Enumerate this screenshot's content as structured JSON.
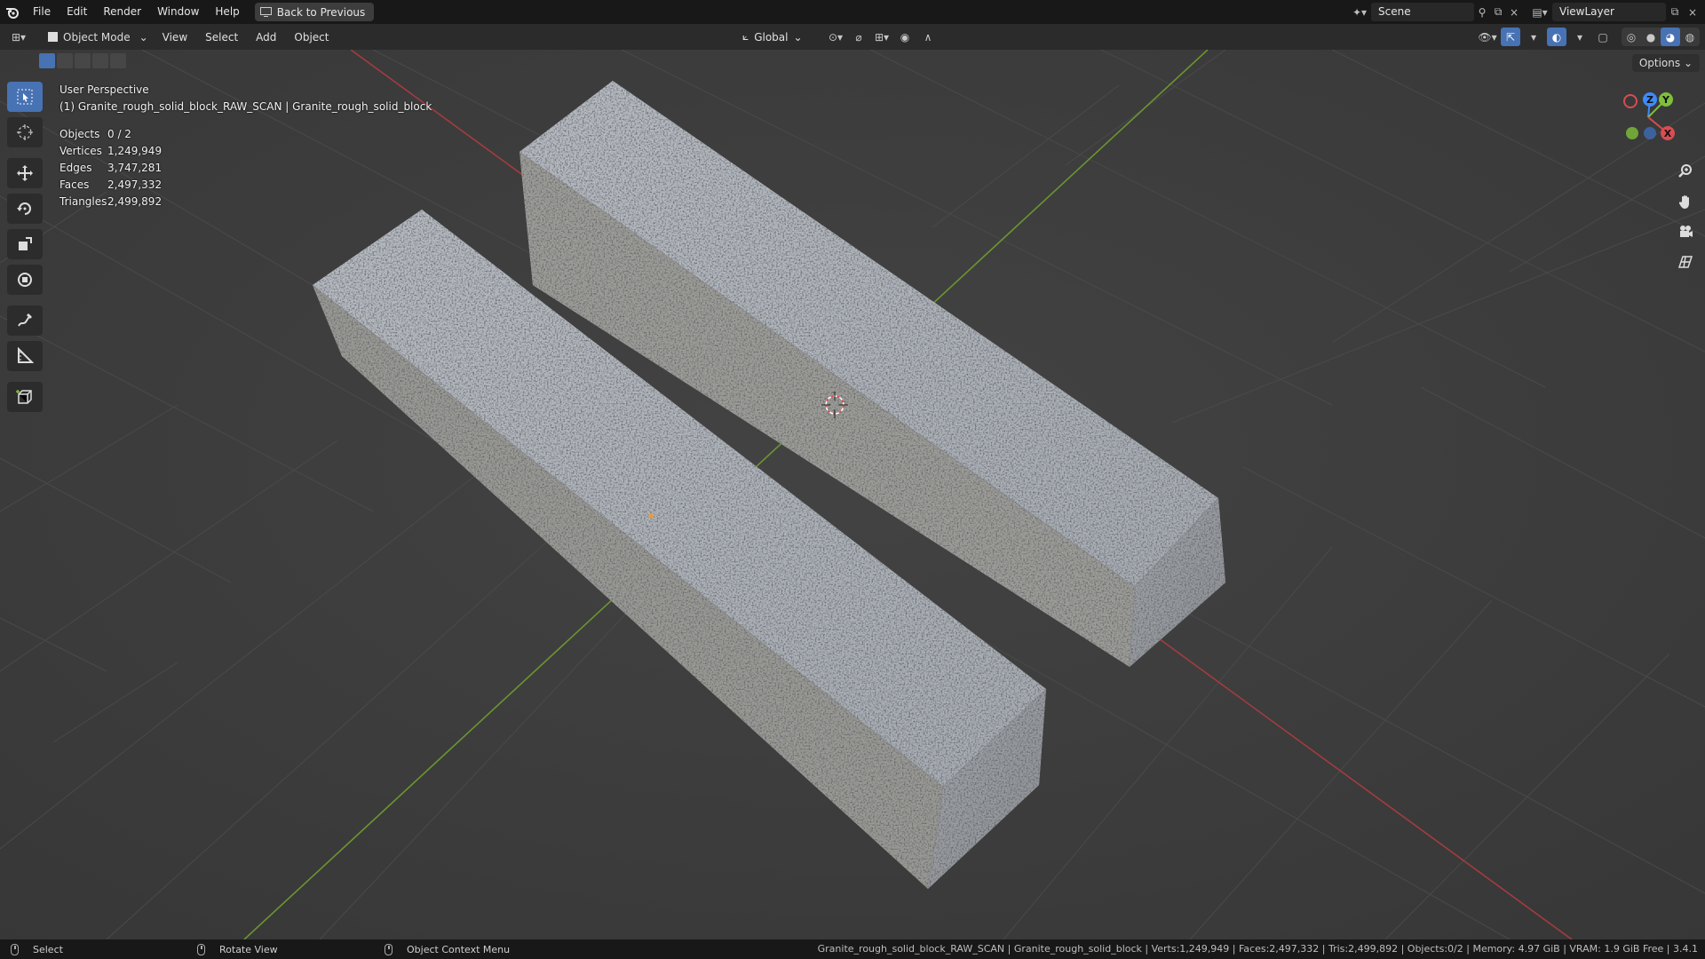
{
  "topbar": {
    "menus": [
      "File",
      "Edit",
      "Render",
      "Window",
      "Help"
    ],
    "back_button": "Back to Previous",
    "scene_label": "Scene",
    "view_layer_label": "ViewLayer"
  },
  "viewport_header": {
    "mode": "Object Mode",
    "menus": [
      "View",
      "Select",
      "Add",
      "Object"
    ],
    "transform_orientation": "Global",
    "options_label": "Options"
  },
  "overlay": {
    "view_name": "User Perspective",
    "object_path": "(1) Granite_rough_solid_block_RAW_SCAN | Granite_rough_solid_block",
    "stats": [
      {
        "key": "Objects",
        "value": "0 / 2"
      },
      {
        "key": "Vertices",
        "value": "1,249,949"
      },
      {
        "key": "Edges",
        "value": "3,747,281"
      },
      {
        "key": "Faces",
        "value": "2,497,332"
      },
      {
        "key": "Triangles",
        "value": "2,499,892"
      }
    ]
  },
  "gizmo": {
    "x_label": "X",
    "y_label": "Y",
    "z_label": "Z"
  },
  "statusbar": {
    "select": "Select",
    "rotate": "Rotate View",
    "context": "Object Context Menu",
    "info": "Granite_rough_solid_block_RAW_SCAN | Granite_rough_solid_block | Verts:1,249,949 | Faces:2,497,332 | Tris:2,499,892 | Objects:0/2 | Memory: 4.97 GiB | VRAM: 1.9 GiB Free | 3.4.1"
  },
  "colors": {
    "accent": "#4772b3",
    "x_axis": "#d84c52",
    "y_axis": "#7fbf3a",
    "z_axis": "#3d8bff",
    "viewport_bg": "#3d3d3d"
  }
}
